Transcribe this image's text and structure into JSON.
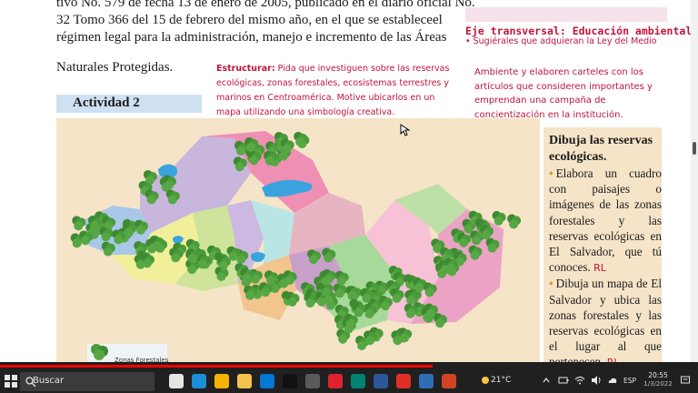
{
  "page": {
    "paragraph_lines": [
      "tivo No. 579 de fecha 13 de enero de 2005, publicado en el diario oficial No.",
      "32 Tomo 366 del 15 de febrero del mismo año, en el que se estableceel",
      "régimen legal para la administración, manejo e incremento de las Áreas"
    ],
    "paragraph_end": "Naturales Protegidas.",
    "activity_title": "Actividad 2",
    "estructurar_label": "Estructurar:",
    "estructurar_text": " Pida que investiguen sobre las reservas ecológicas, zonas forestales, ecosistemas terrestres y marinos en Centroamérica. Motive ubicarlos en un mapa utilizando una simbología creativa.",
    "eje_title": "Eje transversal: Educación ambiental",
    "eje_bullet": "• Sugiérales que adquieran la Ley del Medio",
    "eje_body": "Ambiente y elaboren carteles con los artículos que consideren importantes y emprendan una campaña de concientización en la institución.",
    "legend_label": "Zonas Forestales",
    "instructions_title": "Dibuja las reservas ecológicas.",
    "instructions": [
      {
        "text": "Elabora un cuadro con paisajes o imágenes de las zonas forestales y las reservas ecológicas en El Salvador, que tú conoces.",
        "tag": "RL"
      },
      {
        "text": "Dibuja un mapa de El Salvador y ubica las zonas forestales y las reservas ecológicas en el lugar al que pertenecen.",
        "tag": "RL"
      }
    ]
  },
  "video": {
    "progress_fraction": 0.62
  },
  "taskbar": {
    "search_label": "Buscar",
    "temperature": "21°C",
    "language": "ESP",
    "time": "20:55",
    "date": "1/3/2022",
    "apps": [
      {
        "name": "task-view-icon",
        "color": "#e5e5e5"
      },
      {
        "name": "edge-icon",
        "color": "#1a8fd8"
      },
      {
        "name": "chrome-icon",
        "color": "#f4b400"
      },
      {
        "name": "file-explorer-icon",
        "color": "#f2c14e"
      },
      {
        "name": "store-icon",
        "color": "#0078d4"
      },
      {
        "name": "tiktok-icon",
        "color": "#111111"
      },
      {
        "name": "app-g-icon",
        "color": "#5a5a5a"
      },
      {
        "name": "opera-icon",
        "color": "#e0212e"
      },
      {
        "name": "sway-icon",
        "color": "#008272"
      },
      {
        "name": "word-icon",
        "color": "#2b579a"
      },
      {
        "name": "acrobat-icon",
        "color": "#e02f26"
      },
      {
        "name": "capture-icon",
        "color": "#2f6db5"
      },
      {
        "name": "powerpoint-icon",
        "color": "#d04423"
      }
    ]
  },
  "colors": {
    "accent_red": "#c0143c",
    "map_background": "#f5e4c8",
    "activity_band": "#cfe0f3",
    "progress": "#ff0000"
  }
}
